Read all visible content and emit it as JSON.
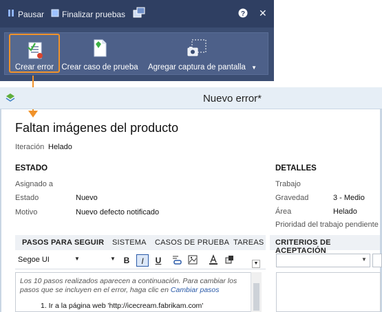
{
  "toolbar": {
    "pause_label": "Pausar",
    "finish_label": "Finalizar pruebas",
    "help_icon": "help-icon",
    "close_glyph": "✕"
  },
  "ribbon": {
    "create_bug_label": "Crear error",
    "create_test_case_label": "Crear caso de prueba",
    "capture_label": "Agregar captura de pantalla",
    "dropdown_glyph": "▼"
  },
  "window": {
    "title": "Nuevo error*"
  },
  "form": {
    "title": "Faltan imágenes del producto",
    "iteration_label": "Iteración",
    "iteration_value": "Helado",
    "state_section": "ESTADO",
    "assigned_label": "Asignado a",
    "assigned_value": "",
    "state_label": "Estado",
    "state_value": "Nuevo",
    "reason_label": "Motivo",
    "reason_value": "Nuevo defecto notificado",
    "details_section": "DETALLES",
    "work_label": "Trabajo",
    "severity_label": "Gravedad",
    "severity_value": "3 - Medio",
    "area_label": "Área",
    "area_value": "Helado",
    "priority_label": "Prioridad del trabajo pendiente"
  },
  "tabs": {
    "steps": "PASOS PARA SEGUIR",
    "system": "SISTEMA",
    "test_cases": "CASOS DE PRUEBA",
    "tasks": "TAREAS",
    "acceptance": "CRITERIOS DE ACEPTACIÓN"
  },
  "editor": {
    "font": "Segoe UI",
    "bold": "B",
    "italic": "I",
    "underline": "U",
    "note_text": "Los 10 pasos realizados aparecen a continuación. Para cambiar los pasos que se incluyen en el error, haga clic en ",
    "note_link": "Cambiar pasos",
    "step_1": "1. Ir a la página web 'http://icecream.fabrikam.com'"
  },
  "colors": {
    "toolbar_bg": "#3b4d72",
    "accent_orange": "#f0922a",
    "link_blue": "#2a5aa8"
  }
}
